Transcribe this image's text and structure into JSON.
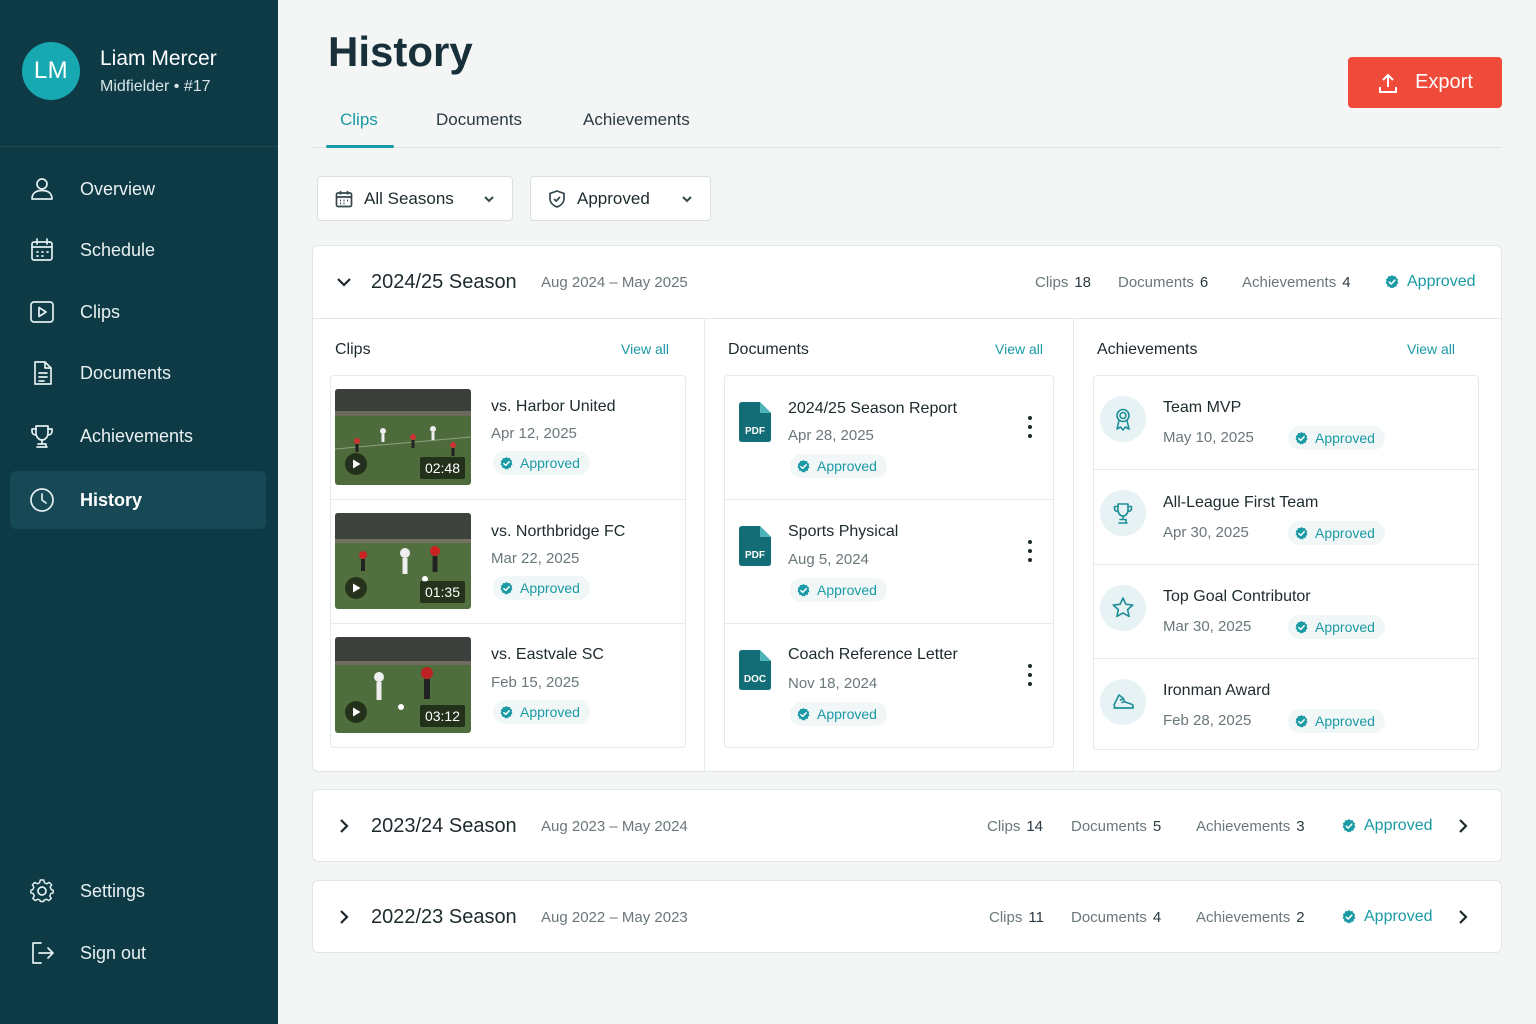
{
  "profile": {
    "initials": "LM",
    "name": "Liam Mercer",
    "role": "Midfielder • #17"
  },
  "nav": {
    "overview": "Overview",
    "schedule": "Schedule",
    "clips": "Clips",
    "documents": "Documents",
    "achievements": "Achievements",
    "history": "History",
    "settings": "Settings",
    "signout": "Sign out"
  },
  "page": {
    "title": "History",
    "export_label": "Export"
  },
  "tabs": {
    "clips": "Clips",
    "documents": "Documents",
    "achievements": "Achievements"
  },
  "filters": {
    "season": "All Seasons",
    "status": "Approved"
  },
  "seasons": [
    {
      "name": "2024/25 Season",
      "range": "Aug 2024 – May 2025",
      "clips_label": "Clips",
      "clips": "18",
      "docs_label": "Documents",
      "docs": "6",
      "ach_label": "Achievements",
      "ach": "4",
      "status": "Approved",
      "clips_title": "Clips",
      "docs_title": "Documents",
      "ach_title": "Achievements",
      "view_all": "View all",
      "clip_items": [
        {
          "title": "vs. Harbor United",
          "date": "Apr 12, 2025",
          "duration": "02:48",
          "status": "Approved"
        },
        {
          "title": "vs. Northbridge FC",
          "date": "Mar 22, 2025",
          "duration": "01:35",
          "status": "Approved"
        },
        {
          "title": "vs. Eastvale SC",
          "date": "Feb 15, 2025",
          "duration": "03:12",
          "status": "Approved"
        }
      ],
      "doc_items": [
        {
          "title": "2024/25 Season Report",
          "date": "Apr 28, 2025",
          "type": "PDF",
          "status": "Approved"
        },
        {
          "title": "Sports Physical",
          "date": "Aug 5, 2024",
          "type": "PDF",
          "status": "Approved"
        },
        {
          "title": "Coach Reference Letter",
          "date": "Nov 18, 2024",
          "type": "DOC",
          "status": "Approved"
        }
      ],
      "ach_items": [
        {
          "title": "Team MVP",
          "date": "May 10, 2025",
          "icon": "medal-icon",
          "status": "Approved"
        },
        {
          "title": "All-League First Team",
          "date": "Apr 30, 2025",
          "icon": "trophy-icon",
          "status": "Approved"
        },
        {
          "title": "Top Goal Contributor",
          "date": "Mar 30, 2025",
          "icon": "star-icon",
          "status": "Approved"
        },
        {
          "title": "Ironman Award",
          "date": "Feb 28, 2025",
          "icon": "shoe-icon",
          "status": "Approved"
        }
      ]
    },
    {
      "name": "2023/24 Season",
      "range": "Aug 2023 – May 2024",
      "clips_label": "Clips",
      "clips": "14",
      "docs_label": "Documents",
      "docs": "5",
      "ach_label": "Achievements",
      "ach": "3",
      "status": "Approved"
    },
    {
      "name": "2022/23 Season",
      "range": "Aug 2022 – May 2023",
      "clips_label": "Clips",
      "clips": "11",
      "docs_label": "Documents",
      "docs": "4",
      "ach_label": "Achievements",
      "ach": "2",
      "status": "Approved"
    }
  ],
  "colors": {
    "sidebar": "#0d3a45",
    "accent": "#1a9aa5",
    "export": "#ef4a3a"
  }
}
